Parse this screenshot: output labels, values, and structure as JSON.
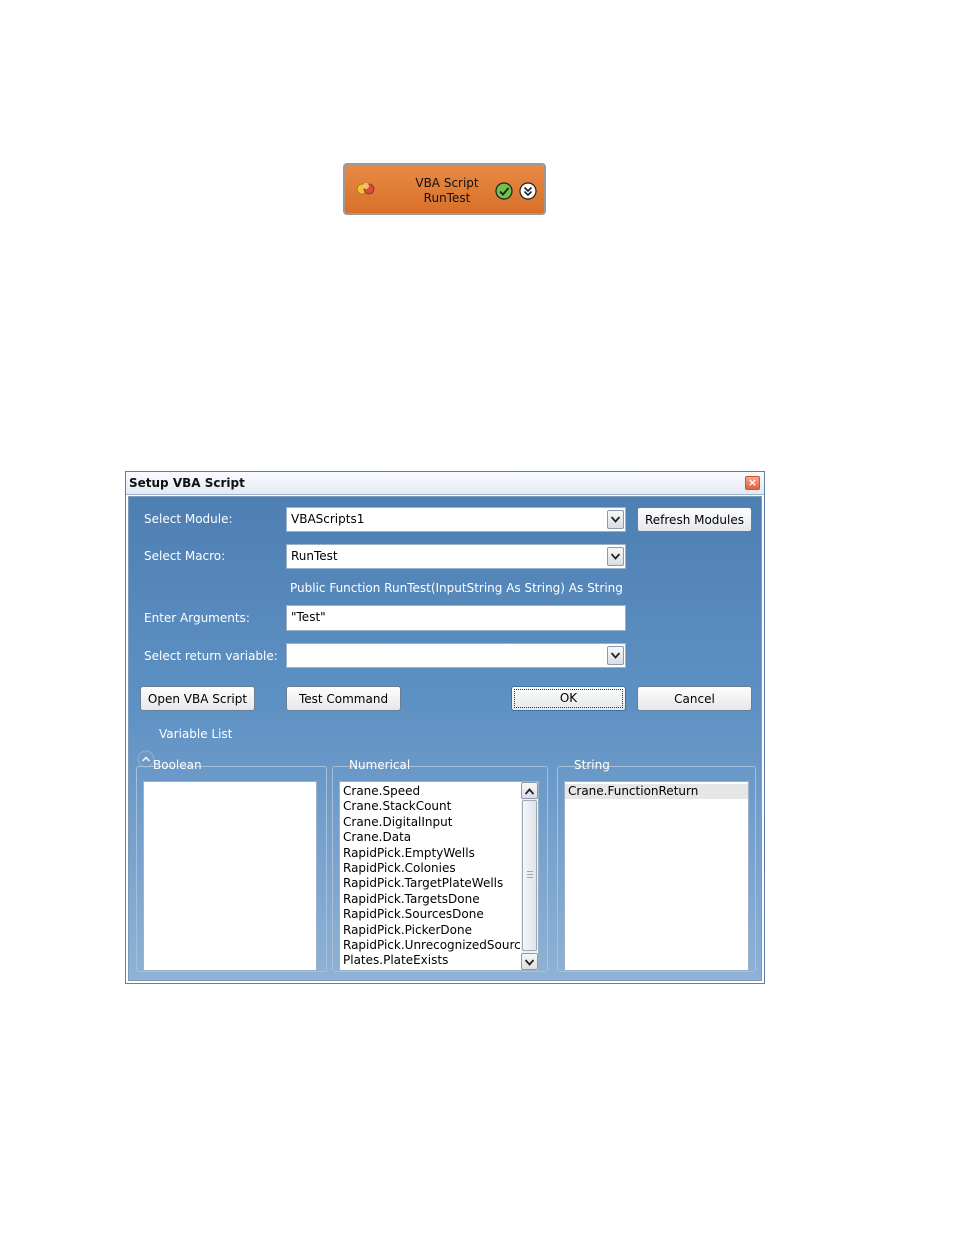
{
  "node": {
    "title": "VBA Script",
    "subtitle": "RunTest",
    "icon": "colored-dots-icon",
    "status_icon": "check-circle-icon",
    "expand_icon": "double-chevron-down-icon",
    "color": "#de7b35"
  },
  "dialog": {
    "title": "Setup VBA Script",
    "close_icon": "close-icon",
    "module": {
      "label": "Select Module:",
      "value": "VBAScripts1"
    },
    "refresh_label": "Refresh Modules",
    "macro": {
      "label": "Select Macro:",
      "value": "RunTest"
    },
    "signature": "Public Function RunTest(InputString As String) As String",
    "arguments": {
      "label": "Enter Arguments:",
      "value": "\"Test\""
    },
    "return_var": {
      "label": "Select return variable:",
      "value": ""
    },
    "buttons": {
      "open": "Open VBA Script",
      "test": "Test Command",
      "ok": "OK",
      "cancel": "Cancel"
    },
    "variable_list": {
      "label": "Variable List",
      "boolean": {
        "title": "Boolean",
        "items": []
      },
      "numerical": {
        "title": "Numerical",
        "items": [
          "Crane.Speed",
          "Crane.StackCount",
          "Crane.DigitalInput",
          "Crane.Data",
          "RapidPick.EmptyWells",
          "RapidPick.Colonies",
          "RapidPick.TargetPlateWells",
          "RapidPick.TargetsDone",
          "RapidPick.SourcesDone",
          "RapidPick.PickerDone",
          "RapidPick.UnrecognizedSource",
          "Plates.PlateExists"
        ]
      },
      "string": {
        "title": "String",
        "items": [
          "Crane.FunctionReturn"
        ]
      }
    }
  },
  "colors": {
    "dialog_body_top": "#4e7fb3",
    "dialog_body_bottom": "#8fb2d6"
  }
}
